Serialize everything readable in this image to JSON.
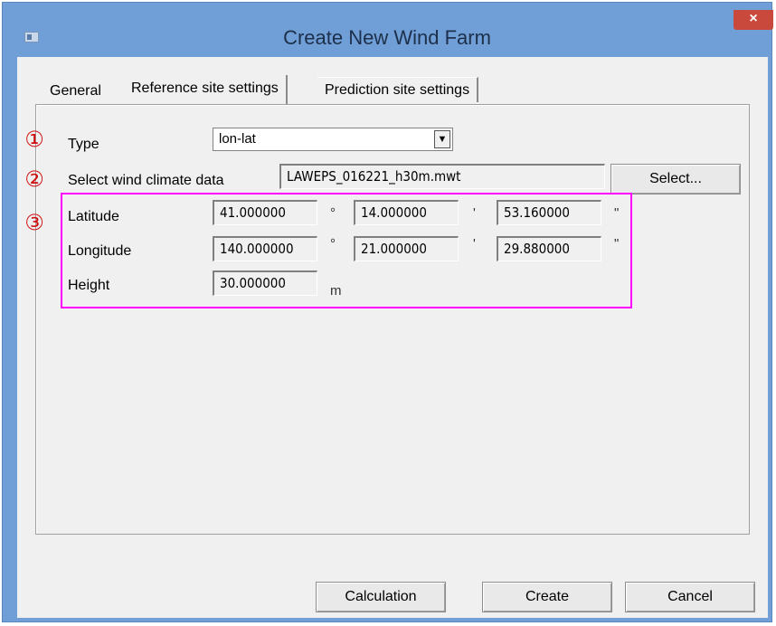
{
  "window": {
    "title": "Create New Wind Farm",
    "close_glyph": "×"
  },
  "tabs": [
    {
      "label": "General"
    },
    {
      "label": "Reference site settings",
      "active": true
    },
    {
      "label": "Prediction site settings"
    }
  ],
  "markers": [
    "①",
    "②",
    "③"
  ],
  "type": {
    "label": "Type",
    "value": "lon-lat",
    "arrow": "▼"
  },
  "climate": {
    "label": "Select wind climate data",
    "value": "LAWEPS_016221_h30m.mwt",
    "button": "Select..."
  },
  "coords": {
    "latitude": {
      "label": "Latitude",
      "deg": "41.000000",
      "min": "14.000000",
      "sec": "53.160000"
    },
    "longitude": {
      "label": "Longitude",
      "deg": "140.000000",
      "min": "21.000000",
      "sec": "29.880000"
    },
    "height": {
      "label": "Height",
      "value": "30.000000",
      "unit": "m"
    },
    "units": {
      "deg": "°",
      "min": "'",
      "sec": "\""
    }
  },
  "footer": {
    "calculation": "Calculation",
    "create": "Create",
    "cancel": "Cancel"
  },
  "colors": {
    "highlight": "#ff00ff",
    "marker": "#d01010",
    "titlebar": "#6f9fd6",
    "close": "#c9493c"
  }
}
